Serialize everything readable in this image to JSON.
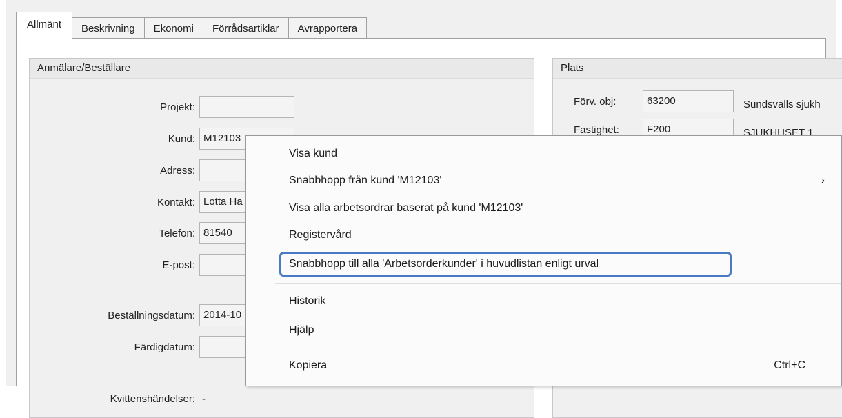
{
  "tabs": [
    "Allmänt",
    "Beskrivning",
    "Ekonomi",
    "Förrådsartiklar",
    "Avrapportera"
  ],
  "left_group": {
    "title": "Anmälare/Beställare",
    "fields": {
      "projekt": {
        "label": "Projekt:",
        "value": ""
      },
      "kund": {
        "label": "Kund:",
        "value": "M12103"
      },
      "adress": {
        "label": "Adress:",
        "value": ""
      },
      "kontakt": {
        "label": "Kontakt:",
        "value": "Lotta Ha"
      },
      "telefon": {
        "label": "Telefon:",
        "value": "81540"
      },
      "epost": {
        "label": "E-post:",
        "value": ""
      },
      "bestallningsdatum": {
        "label": "Beställningsdatum:",
        "value": "2014-10"
      },
      "fardigdatum": {
        "label": "Färdigdatum:",
        "value": ""
      },
      "kvittens": {
        "label": "Kvittenshändelser:",
        "value": "-"
      }
    }
  },
  "right_group": {
    "title": "Plats",
    "forv_obj": {
      "label": "Förv. obj:",
      "value": "63200",
      "desc": "Sundsvalls sjukh"
    },
    "fastighet": {
      "label": "Fastighet:",
      "value": "F200",
      "desc": "SJUKHUSET 1"
    }
  },
  "context_menu": {
    "visa_kund": "Visa kund",
    "snabbhopp_fran": "Snabbhopp från kund 'M12103'",
    "submenu_arrow": "›",
    "visa_alla": "Visa alla arbetsordrar baserat på kund 'M12103'",
    "registervard": "Registervård",
    "snabbhopp_till": "Snabbhopp till alla 'Arbetsorderkunder' i huvudlistan enligt urval",
    "historik": "Historik",
    "hjalp": "Hjälp",
    "kopiera": "Kopiera",
    "kopiera_shortcut": "Ctrl+C"
  },
  "colors": {
    "highlight_border": "#4a7ac4",
    "menu_bg": "#fbfbfb",
    "panel_bg": "#f0f0f0"
  }
}
